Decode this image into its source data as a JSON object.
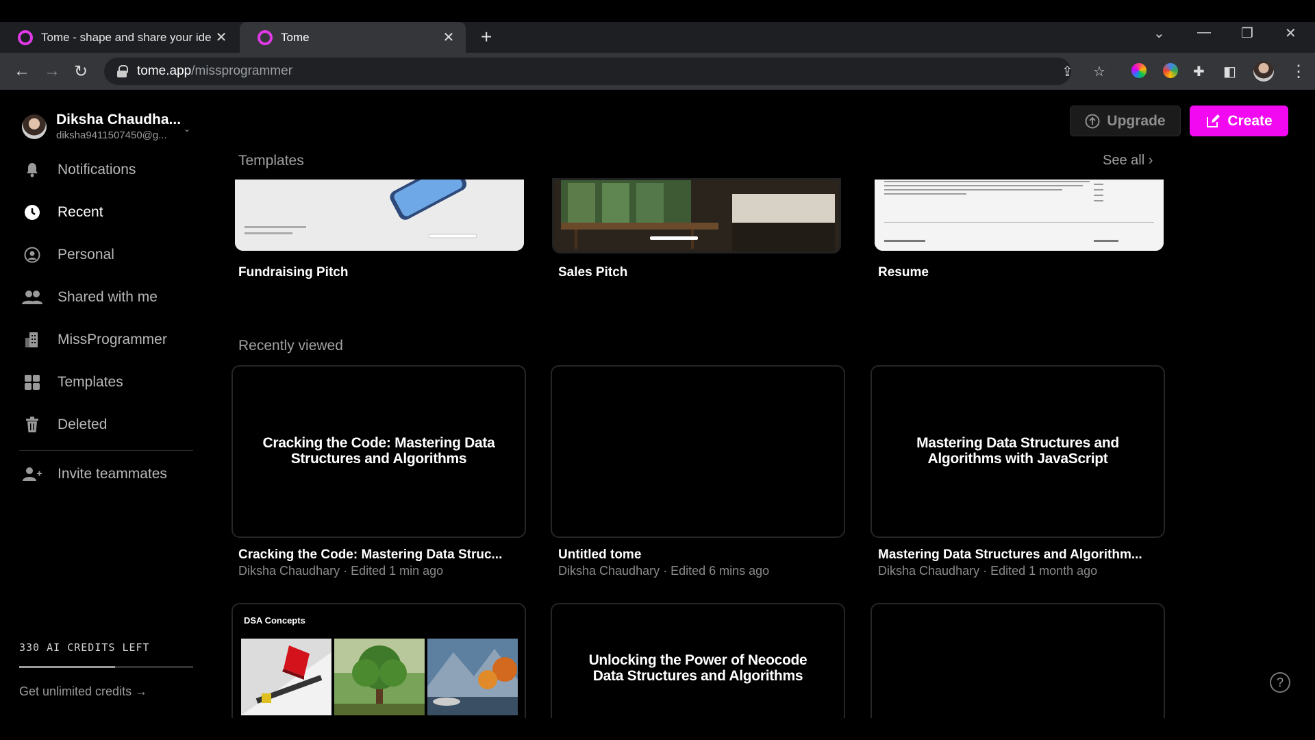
{
  "browser": {
    "tabs": [
      {
        "title": "Tome - shape and share your ide",
        "close": "✕"
      },
      {
        "title": "Tome",
        "close": "✕"
      }
    ],
    "new_tab": "+",
    "url_host": "tome.app",
    "url_path": "/missprogrammer"
  },
  "user": {
    "name": "Diksha Chaudha...",
    "email": "diksha9411507450@g..."
  },
  "sidebar": {
    "items": [
      {
        "label": "Notifications",
        "icon": "bell-icon"
      },
      {
        "label": "Recent",
        "icon": "clock-icon",
        "active": true
      },
      {
        "label": "Personal",
        "icon": "user-circle-icon"
      },
      {
        "label": "Shared with me",
        "icon": "users-icon"
      },
      {
        "label": "MissProgrammer",
        "icon": "building-icon"
      },
      {
        "label": "Templates",
        "icon": "grid-icon"
      },
      {
        "label": "Deleted",
        "icon": "trash-icon"
      }
    ],
    "invite": "Invite teammates",
    "credits": "330 AI CREDITS LEFT",
    "credits_fraction": 0.55,
    "unlimited": "Get unlimited credits"
  },
  "header": {
    "upgrade": "Upgrade",
    "create": "Create"
  },
  "templates": {
    "title": "Templates",
    "see_all": "See all",
    "items": [
      {
        "label": "Fundraising Pitch"
      },
      {
        "label": "Sales Pitch"
      },
      {
        "label": "Resume"
      }
    ]
  },
  "recent": {
    "title": "Recently viewed",
    "cards": [
      {
        "preview": "Cracking the Code: Mastering Data Structures and Algorithms",
        "title": "Cracking the Code: Mastering Data Struc...",
        "meta": "Diksha Chaudhary · Edited 1 min ago"
      },
      {
        "preview": "",
        "title": "Untitled tome",
        "meta": "Diksha Chaudhary · Edited 6 mins ago"
      },
      {
        "preview": "Mastering Data Structures and Algorithms with JavaScript",
        "title": "Mastering Data Structures and Algorithm...",
        "meta": "Diksha Chaudhary · Edited 1 month ago"
      },
      {
        "preview": "DSA Concepts"
      },
      {
        "preview": "Unlocking the Power of Neocode Data Structures and Algorithms"
      },
      {
        "preview": ""
      }
    ]
  },
  "colors": {
    "accent": "#f209f2",
    "background": "#000000"
  }
}
